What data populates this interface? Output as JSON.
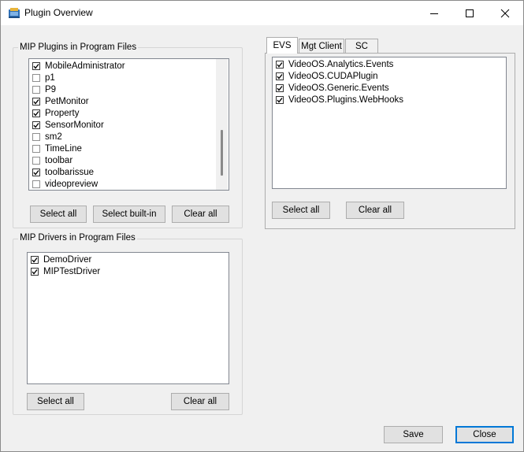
{
  "window": {
    "title": "Plugin Overview"
  },
  "plugins_group": {
    "label": "MIP Plugins in Program Files",
    "items": [
      {
        "label": "MobileAdministrator",
        "checked": true
      },
      {
        "label": "p1",
        "checked": false
      },
      {
        "label": "P9",
        "checked": false
      },
      {
        "label": "PetMonitor",
        "checked": true
      },
      {
        "label": "Property",
        "checked": true
      },
      {
        "label": "SensorMonitor",
        "checked": true
      },
      {
        "label": "sm2",
        "checked": false
      },
      {
        "label": "TimeLine",
        "checked": false
      },
      {
        "label": "toolbar",
        "checked": false
      },
      {
        "label": "toolbarissue",
        "checked": true
      },
      {
        "label": "videopreview",
        "checked": false
      }
    ],
    "select_all_label": "Select all",
    "select_builtin_label": "Select built-in",
    "clear_all_label": "Clear all"
  },
  "drivers_group": {
    "label": "MIP Drivers in Program Files",
    "items": [
      {
        "label": "DemoDriver",
        "checked": true
      },
      {
        "label": "MIPTestDriver",
        "checked": true
      }
    ],
    "select_all_label": "Select all",
    "clear_all_label": "Clear all"
  },
  "tabs": {
    "items": [
      {
        "label": "EVS",
        "active": true
      },
      {
        "label": "Mgt Client",
        "active": false
      },
      {
        "label": "SC",
        "active": false
      }
    ],
    "evs_items": [
      {
        "label": "VideoOS.Analytics.Events",
        "checked": true
      },
      {
        "label": "VideoOS.CUDAPlugin",
        "checked": true
      },
      {
        "label": "VideoOS.Generic.Events",
        "checked": true
      },
      {
        "label": "VideoOS.Plugins.WebHooks",
        "checked": true
      }
    ],
    "select_all_label": "Select all",
    "clear_all_label": "Clear all"
  },
  "footer": {
    "save_label": "Save",
    "close_label": "Close"
  }
}
